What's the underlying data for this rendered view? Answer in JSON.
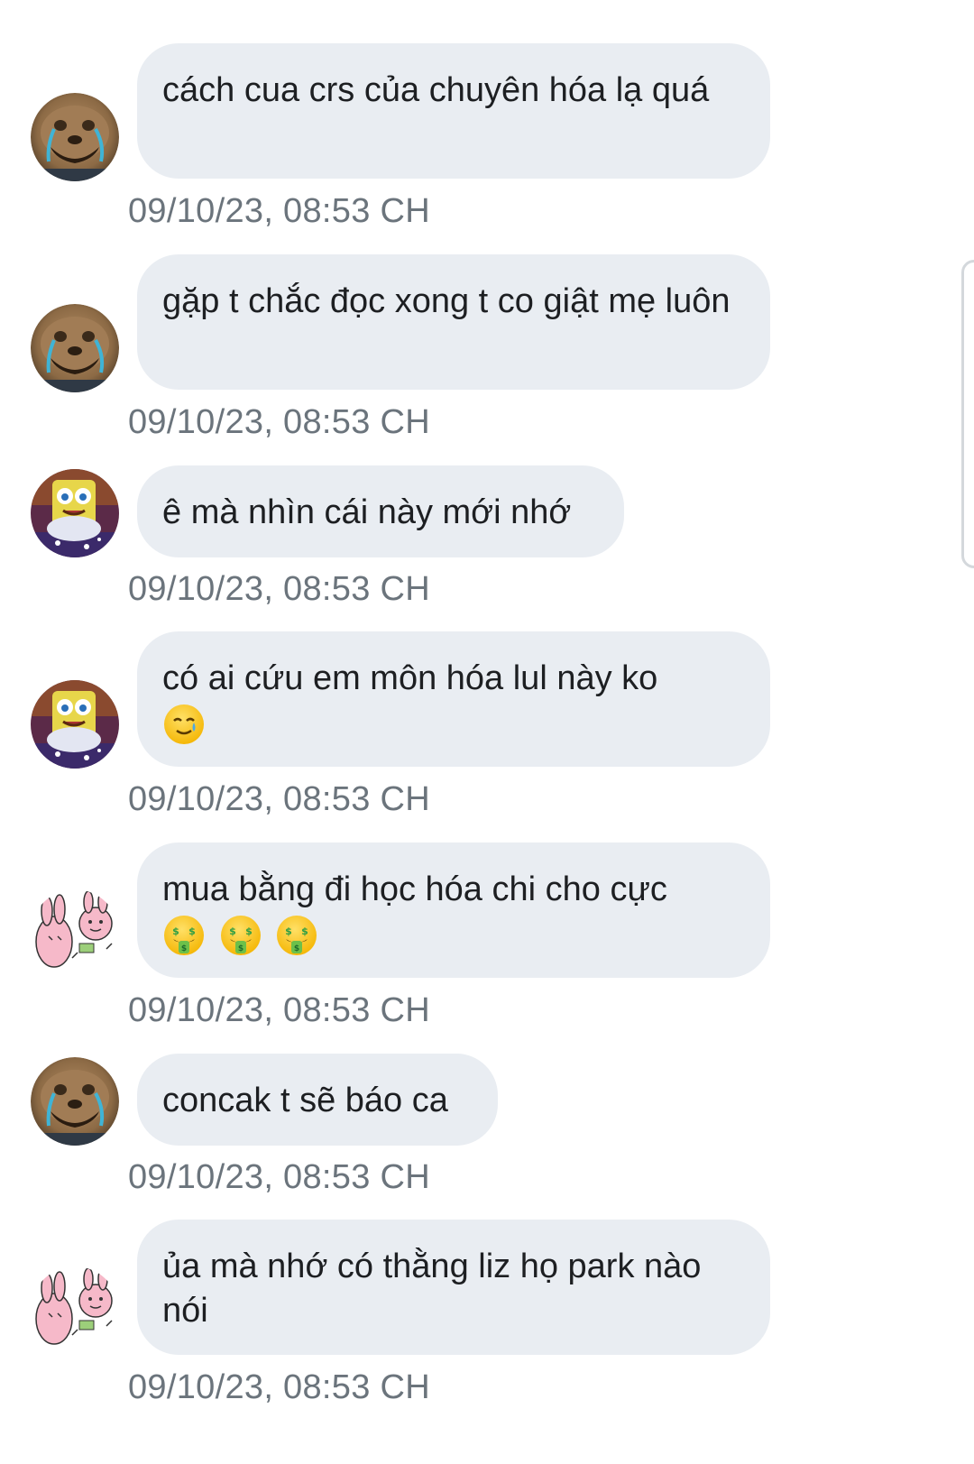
{
  "messages": [
    {
      "avatar": "crying-dog-avatar",
      "text": "cách cua crs của chuyên hóa lạ quá",
      "emojis": [],
      "timestamp": "09/10/23, 08:53 CH"
    },
    {
      "avatar": "crying-dog-avatar",
      "text": "gặp t chắc đọc xong t co giật mẹ luôn",
      "emojis": [],
      "timestamp": "09/10/23, 08:53 CH"
    },
    {
      "avatar": "crying-sponge-avatar",
      "text": "ê mà nhìn cái này mới nhớ",
      "emojis": [],
      "timestamp": "09/10/23, 08:53 CH"
    },
    {
      "avatar": "crying-sponge-avatar",
      "text": "có ai cứu em môn hóa lul này ko",
      "emojis": [
        "smiling-face-with-tear-emoji"
      ],
      "timestamp": "09/10/23, 08:53 CH"
    },
    {
      "avatar": "pink-bunny-sketch-avatar",
      "text": "mua bằng đi học hóa chi cho cực",
      "emojis": [
        "money-mouth-face-emoji",
        "money-mouth-face-emoji",
        "money-mouth-face-emoji"
      ],
      "timestamp": "09/10/23, 08:53 CH"
    },
    {
      "avatar": "crying-dog-avatar",
      "text": "concak t sẽ báo ca",
      "emojis": [],
      "timestamp": "09/10/23, 08:53 CH"
    },
    {
      "avatar": "pink-bunny-sketch-avatar",
      "text": "ủa mà nhớ có thằng liz họ park nào nói",
      "emojis": [],
      "timestamp": "09/10/23, 08:53 CH"
    }
  ],
  "colors": {
    "bubble": "#e9edf2",
    "text": "#1d1f22",
    "timestamp": "#6b747c"
  }
}
